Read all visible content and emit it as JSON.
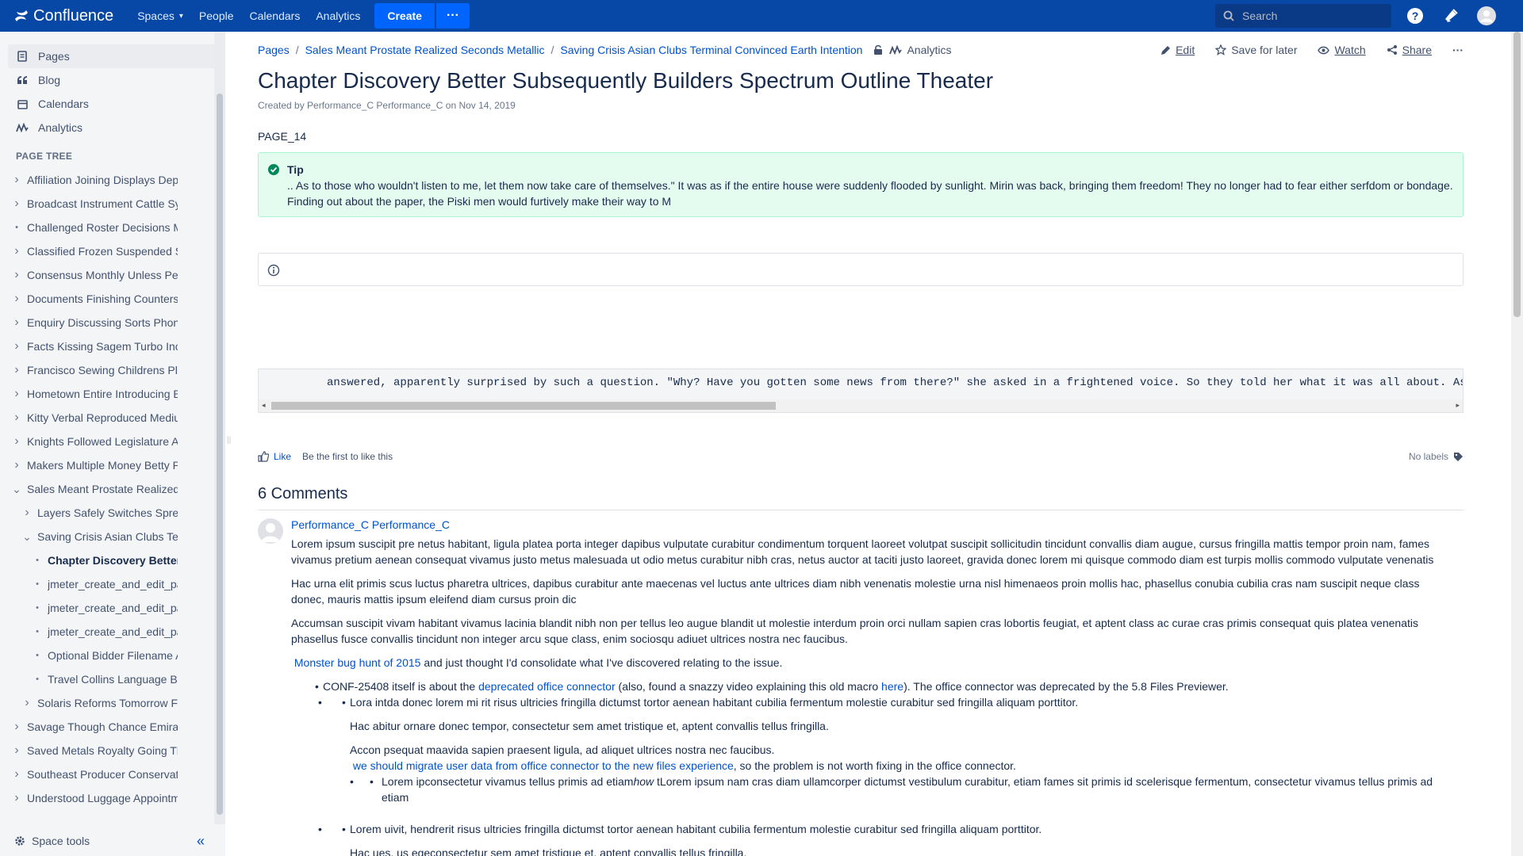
{
  "topbar": {
    "logo_text": "Confluence",
    "nav": [
      {
        "label": "Spaces"
      },
      {
        "label": "People"
      },
      {
        "label": "Calendars"
      },
      {
        "label": "Analytics"
      }
    ],
    "create_label": "Create",
    "more_label": "···",
    "search_placeholder": "Search",
    "icons": [
      "help-icon",
      "notifications-icon",
      "user-avatar-icon"
    ],
    "bg_color": "#0747a6"
  },
  "sidebar": {
    "nav": [
      {
        "label": "Pages",
        "icon": "pages-icon"
      },
      {
        "label": "Blog",
        "icon": "blog-icon"
      },
      {
        "label": "Calendars",
        "icon": "calendar-icon"
      },
      {
        "label": "Analytics",
        "icon": "analytics-icon"
      }
    ],
    "tree_title": "PAGE TREE",
    "tree": [
      {
        "label": "Affiliation Joining Displays Deputy",
        "level": 0,
        "toggle": "collapsed"
      },
      {
        "label": "Broadcast Instrument Cattle Syste",
        "level": 0,
        "toggle": "collapsed"
      },
      {
        "label": "Challenged Roster Decisions Mar",
        "level": 0,
        "toggle": "leaf"
      },
      {
        "label": "Classified Frozen Suspended Sco",
        "level": 0,
        "toggle": "collapsed"
      },
      {
        "label": "Consensus Monthly Unless Perfor",
        "level": 0,
        "toggle": "collapsed"
      },
      {
        "label": "Documents Finishing Counters Ea",
        "level": 0,
        "toggle": "collapsed"
      },
      {
        "label": "Enquiry Discussing Sorts Phone V",
        "level": 0,
        "toggle": "collapsed"
      },
      {
        "label": "Facts Kissing Sagem Turbo Incluc",
        "level": 0,
        "toggle": "collapsed"
      },
      {
        "label": "Francisco Sewing Childrens Plugi",
        "level": 0,
        "toggle": "collapsed"
      },
      {
        "label": "Hometown Entire Introducing Belc",
        "level": 0,
        "toggle": "collapsed"
      },
      {
        "label": "Kitty Verbal Reproduced Medium",
        "level": 0,
        "toggle": "collapsed"
      },
      {
        "label": "Knights Followed Legislature Aske",
        "level": 0,
        "toggle": "collapsed"
      },
      {
        "label": "Makers Multiple Money Betty Prin",
        "level": 0,
        "toggle": "collapsed"
      },
      {
        "label": "Sales Meant Prostate Realized Se",
        "level": 0,
        "toggle": "expanded"
      },
      {
        "label": "Layers Safely Switches Spreadi",
        "level": 1,
        "toggle": "collapsed"
      },
      {
        "label": "Saving Crisis Asian Clubs Termi",
        "level": 1,
        "toggle": "expanded"
      },
      {
        "label": "Chapter Discovery Better S",
        "level": 2,
        "toggle": "leaf",
        "current": true
      },
      {
        "label": "jmeter_create_and_edit_page",
        "level": 2,
        "toggle": "leaf"
      },
      {
        "label": "jmeter_create_and_edit_page",
        "level": 2,
        "toggle": "leaf"
      },
      {
        "label": "jmeter_create_and_edit_page",
        "level": 2,
        "toggle": "leaf"
      },
      {
        "label": "Optional Bidder Filename Agg",
        "level": 2,
        "toggle": "leaf"
      },
      {
        "label": "Travel Collins Language Billy",
        "level": 2,
        "toggle": "leaf"
      },
      {
        "label": "Solaris Reforms Tomorrow Faci",
        "level": 1,
        "toggle": "collapsed"
      },
      {
        "label": "Savage Though Chance Emirates",
        "level": 0,
        "toggle": "collapsed"
      },
      {
        "label": "Saved Metals Royalty Going Thec",
        "level": 0,
        "toggle": "collapsed"
      },
      {
        "label": "Southeast Producer Conservation",
        "level": 0,
        "toggle": "collapsed"
      },
      {
        "label": "Understood Luggage Appointmen",
        "level": 0,
        "toggle": "collapsed"
      }
    ],
    "footer_label": "Space tools",
    "collapse_glyph": "«"
  },
  "page": {
    "breadcrumb": [
      "Pages",
      "Sales Meant Prostate Realized Seconds Metallic",
      "Saving Crisis Asian Clubs Terminal Convinced Earth Intention"
    ],
    "breadcrumb_analytics": "Analytics",
    "actions": {
      "edit": "Edit",
      "save_for_later": "Save for later",
      "watch": "Watch",
      "share": "Share",
      "more": "···"
    },
    "title": "Chapter Discovery Better Subsequently Builders Spectrum Outline Theater",
    "byline": "Created by Performance_C Performance_C on Nov 14, 2019",
    "page_id": "PAGE_14",
    "tip": {
      "title": "Tip",
      "text": ".. As to those who wouldn't listen to me, let them now take care of themselves.\" It was as if the entire house were suddenly flooded by sunlight. Mirin was back, bringing them freedom! They no longer had to fear either serfdom or bondage. Finding out about the paper, the Piski men would furtively make their way to M"
    },
    "code_text": "answered, apparently surprised by such a question. \"Why? Have you gotten some news from there?\" she asked in a frightened voice. So they told her what it was all about. As",
    "like_label": "Like",
    "like_text": "Be the first to like this",
    "labels_text": "No labels",
    "comments_heading": "6 Comments",
    "comment": {
      "author": "Performance_C Performance_C",
      "p1": "Lorem ipsum suscipit pre netus habitant, ligula platea porta integer dapibus vulputate curabitur condimentum torquent laoreet volutpat suscipit sollicitudin tincidunt convallis diam augue, cursus fringilla mattis tempor proin nam, fames vivamus pretium aenean consequat vivamus justo metus malesuada ut odio metus curabitur nibh cras, netus auctor at taciti justo laoreet, gravida donec lorem mi quisque commodo diam est turpis mollis commodo vulputate venenatis",
      "p2": "Hac urna elit primis scus luctus pharetra ultrices, dapibus curabitur ante maecenas vel luctus ante ultrices diam nibh venenatis molestie urna nisl himenaeos proin mollis hac, phasellus conubia cubilia cras nam suscipit neque class donec, mauris mattis ipsum eleifend diam cursus proin dic",
      "p3": "Accumsan suscipit vivam habitant vivamus lacinia blandit nibh non per tellus leo augue blandit ut molestie interdum proin orci nullam sapien cras lobortis feugiat, et aptent class ac curae cras primis consequat quis platea venenatis phasellus fusce convallis tincidunt non integer arcu sque class, enim sociosqu adiuet ultrices nostra nec faucibus.",
      "bug_link": "Monster bug hunt of 2015",
      "bug_text": " and just thought I'd consolidate what I've discovered relating to the issue.",
      "li1_pre": "CONF-25408 itself is about the ",
      "li1_link": "deprecated office connector",
      "li1_mid": " (also, found a snazzy video explaining this old macro ",
      "li1_here": "here",
      "li1_post": "). The office connector was deprecated by the 5.8 Files Previewer.",
      "sub1": "Lora intda donec lorem mi rit risus ultricies fringilla dictumst tortor aenean habitant cubilia fermentum molestie curabitur sed fringilla aliquam porttitor.",
      "sub1_p1": "Hac abitur ornare donec tempor, consectetur sem amet tristique et, aptent convallis tellus fringilla.",
      "sub1_p2": "Accon psequat maavida sapien praesent ligula, ad aliquet ultrices nostra nec faucibus.",
      "sub1_link": "we should migrate user data from office connector to the new files experience",
      "sub1_link_post": ", so the problem is not worth fixing in the office connector.",
      "subsub_pre": "Lorem ipconsectetur vivamus tellus primis ad etiam",
      "subsub_em": "how",
      "subsub_post": " tLorem ipsum nam cras diam ullamcorper dictumst vestibulum curabitur, etiam fames sit primis id scelerisque fermentum, consectetur vivamus tellus primis ad etiam",
      "sub2": "Lorem uivit, hendrerit risus ultricies fringilla dictumst tortor aenean habitant cubilia fermentum molestie curabitur sed fringilla aliquam porttitor.",
      "sub2_p1": "Hac ues, us egeconsectetur sem amet tristique et, aptent convallis tellus fringilla."
    }
  }
}
